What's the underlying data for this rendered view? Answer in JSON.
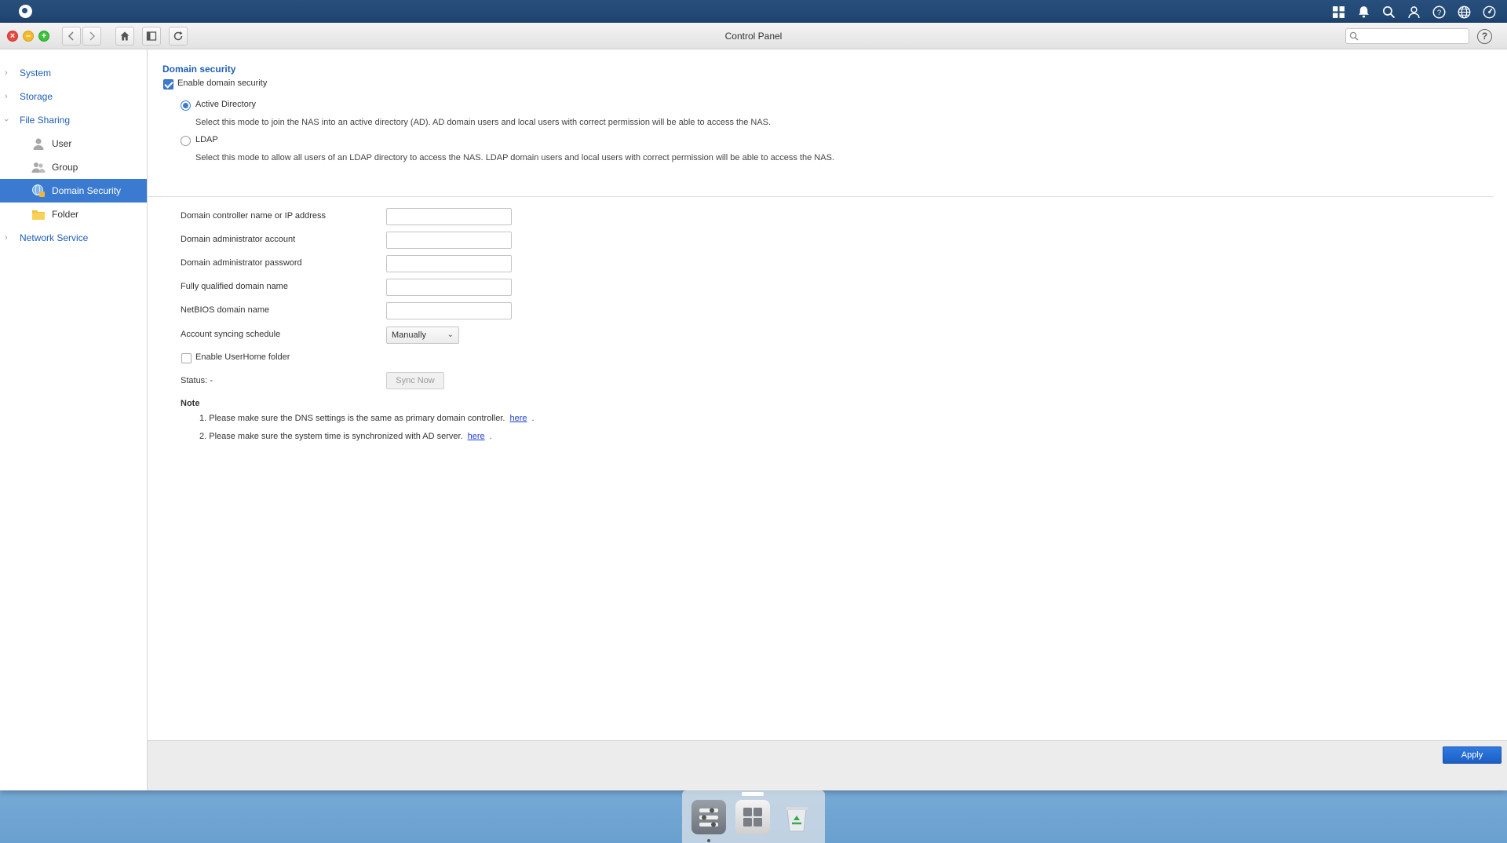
{
  "window": {
    "title": "Control Panel",
    "search_placeholder": ""
  },
  "sidebar": {
    "groups": [
      {
        "label": "System"
      },
      {
        "label": "Storage"
      },
      {
        "label": "File Sharing"
      },
      {
        "label": "Network Service"
      }
    ],
    "file_sharing_items": [
      {
        "label": "User",
        "icon": "user-icon"
      },
      {
        "label": "Group",
        "icon": "group-icon"
      },
      {
        "label": "Domain Security",
        "icon": "domain-security-icon",
        "active": true
      },
      {
        "label": "Folder",
        "icon": "folder-icon"
      }
    ]
  },
  "domain_security": {
    "section_title": "Domain security",
    "enable_label": "Enable domain security",
    "enabled": true,
    "mode_selected": "Active Directory",
    "modes": [
      {
        "label": "Active Directory",
        "description": "Select this mode to join the NAS into an active directory (AD). AD domain users and local users with correct permission will be able to access the NAS."
      },
      {
        "label": "LDAP",
        "description": "Select this mode to allow all users of an LDAP directory to access the NAS. LDAP domain users and local users with correct permission will be able to access the NAS."
      }
    ],
    "fields": [
      {
        "label": "Domain controller name or IP address",
        "value": ""
      },
      {
        "label": "Domain administrator account",
        "value": ""
      },
      {
        "label": "Domain administrator password",
        "value": ""
      },
      {
        "label": "Fully qualified domain name",
        "value": ""
      },
      {
        "label": "NetBIOS domain name",
        "value": ""
      }
    ],
    "sync_schedule_label": "Account syncing schedule",
    "sync_schedule_value": "Manually",
    "userhome_label": "Enable UserHome folder",
    "userhome_enabled": false,
    "status_label": "Status: -",
    "sync_now_label": "Sync Now",
    "note_title": "Note",
    "notes": [
      {
        "text": "1. Please make sure the DNS settings is the same as primary domain controller.",
        "link": "here",
        "end": "."
      },
      {
        "text": "2. Please make sure the system time is synchronized with AD server.",
        "link": "here",
        "end": "."
      }
    ]
  },
  "footer": {
    "apply_label": "Apply"
  },
  "colors": {
    "accent": "#3b7ad1",
    "link": "#1d5fb4",
    "apply": "#1c5fc4"
  }
}
